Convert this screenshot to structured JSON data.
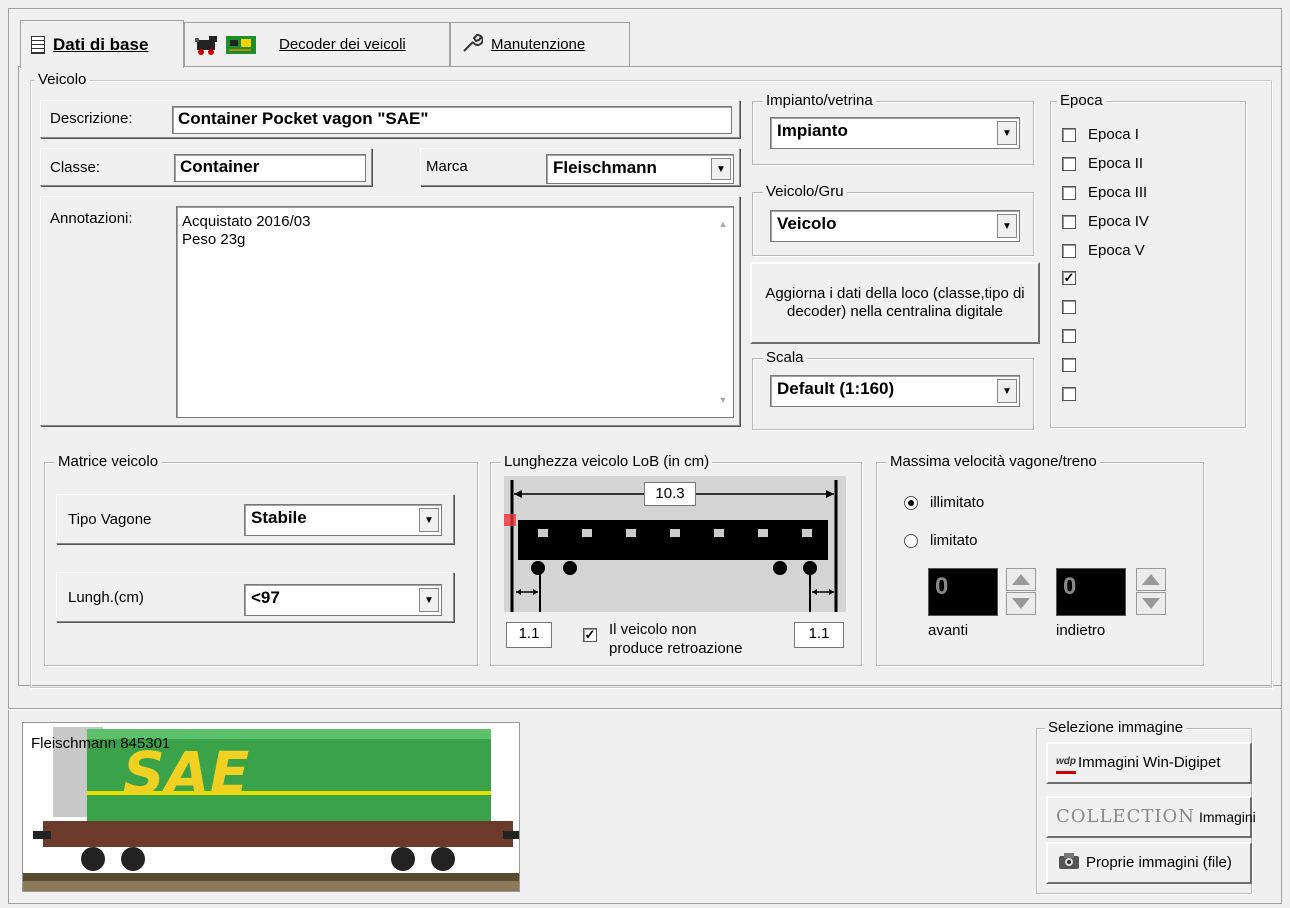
{
  "tabs": {
    "basic": "Dati di base",
    "decoder": "Decoder dei veicoli",
    "maintenance": "Manutenzione"
  },
  "vehicle": {
    "group_label": "Veicolo",
    "description_label": "Descrizione:",
    "description_value": "Container Pocket vagon \"SAE\"",
    "class_label": "Classe:",
    "class_value": "Container",
    "brand_label": "Marca",
    "brand_value": "Fleischmann",
    "notes_label": "Annotazioni:",
    "notes_line1": "Acquistato 2016/03",
    "notes_line2": "Peso 23g"
  },
  "layout_showcase": {
    "label": "Impianto/vetrina",
    "value": "Impianto"
  },
  "vehicle_crane": {
    "label": "Veicolo/Gru",
    "value": "Veicolo"
  },
  "update_button": "Aggiorna i dati della loco (classe,tipo di decoder) nella centralina digitale",
  "scale": {
    "label": "Scala",
    "value": "Default (1:160)"
  },
  "epoch": {
    "label": "Epoca",
    "items": [
      {
        "label": "Epoca I",
        "checked": false
      },
      {
        "label": "Epoca II",
        "checked": false
      },
      {
        "label": "Epoca III",
        "checked": false
      },
      {
        "label": "Epoca IV",
        "checked": false
      },
      {
        "label": "Epoca V",
        "checked": false
      },
      {
        "label": "",
        "checked": true
      },
      {
        "label": "",
        "checked": false
      },
      {
        "label": "",
        "checked": false
      },
      {
        "label": "",
        "checked": false
      },
      {
        "label": "",
        "checked": false
      }
    ],
    "check_mark": "✓"
  },
  "matrix": {
    "label": "Matrice veicolo",
    "wagon_type_label": "Tipo Vagone",
    "wagon_type_value": "Stabile",
    "length_label": "Lungh.(cm)",
    "length_value": "<97"
  },
  "length_lob": {
    "label": "Lunghezza veicolo LoB (in cm)",
    "total": "10.3",
    "left_buffer": "1.1",
    "right_buffer": "1.1",
    "no_feedback_label_1": "Il veicolo non",
    "no_feedback_label_2": "produce retroazione",
    "no_feedback_checked": true
  },
  "max_speed": {
    "label": "Massima velocità vagone/treno",
    "unlimited_label": "illimitato",
    "limited_label": "limitato",
    "selected": "illimitato",
    "forward_value": "0",
    "forward_label": "avanti",
    "backward_value": "0",
    "backward_label": "indietro"
  },
  "image": {
    "caption": "Fleischmann 845301",
    "wagon_logo_text": "SAE"
  },
  "image_selection": {
    "label": "Selezione immagine",
    "windigipet_button": "Immagini Win-Digipet",
    "windigipet_icon_text": "wdp",
    "collection_logo": "COLLECTION",
    "collection_button": "Immagini",
    "own_images_button": "Proprie immagini (file)"
  }
}
